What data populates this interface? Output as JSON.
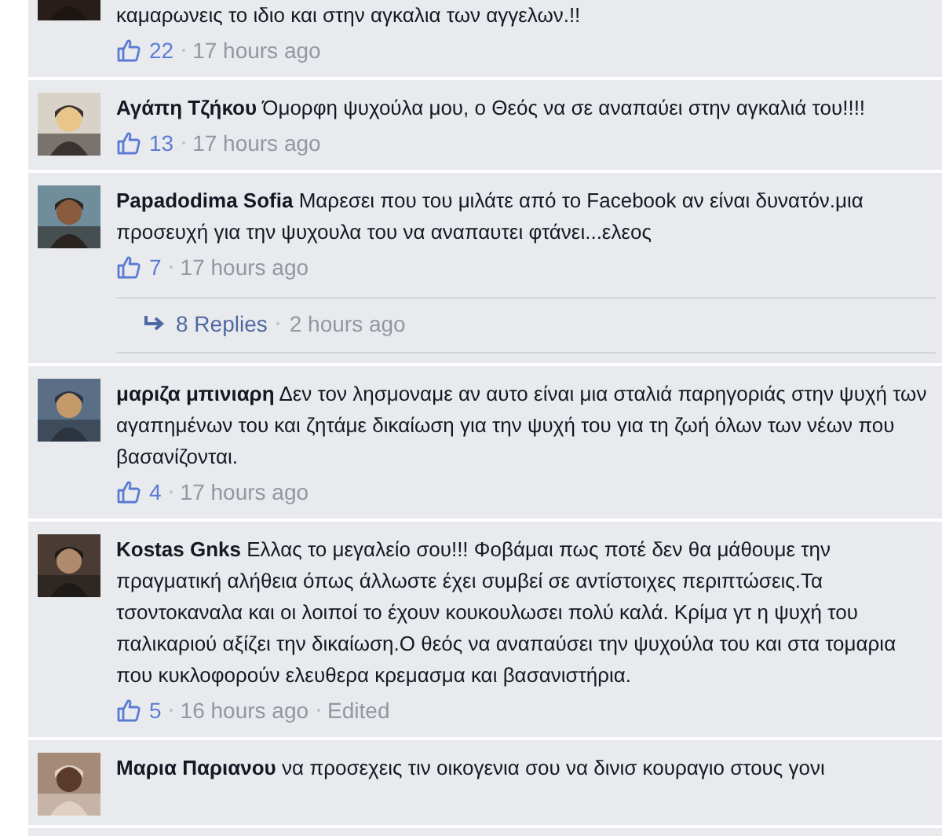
{
  "comments": [
    {
      "text": "καμαρωνεις το ιδιο και στην αγκαλια των αγγελων.!!",
      "likes": "22",
      "time": "17 hours ago"
    },
    {
      "author": "Αγάπη Τζήκου",
      "text": "Όμορφη ψυχούλα μου, ο Θεός να σε αναπαύει στην αγκαλιά του!!!!",
      "likes": "13",
      "time": "17 hours ago"
    },
    {
      "author": "Papadodima Sofia",
      "text": "Μαρεσει που του μιλάτε από το Facebook αν είναι δυνατόν.μια προσευχή για την ψυχουλα του να αναπαυτει φτάνει...ελεος",
      "likes": "7",
      "time": "17 hours ago",
      "replies": {
        "label": "8 Replies",
        "time": "2 hours ago"
      }
    },
    {
      "author": "μαριζα μπινιαρη",
      "text": "Δεν τον λησμοναμε αν αυτο είναι μια σταλιά παρηγοριάς στην ψυχή των αγαπημένων του και ζητάμε δικαίωση για την ψυχή του για τη ζωή όλων των νέων που βασανίζονται.",
      "likes": "4",
      "time": "17 hours ago"
    },
    {
      "author": "Kostas Gnks",
      "text": "Ελλας το μεγαλείο σου!!! Φοβάμαι πως ποτέ δεν θα μάθουμε την πραγματική αλήθεια όπως άλλωστε έχει συμβεί σε αντίστοιχες περιπτώσεις.Τα τσοντοκαναλα και οι λοιποί το έχουν κουκουλωσει πολύ καλά. Κρίμα γτ η ψυχή του παλικαριού αξίζει την δικαίωση.Ο θεός να αναπαύσει την ψυχούλα του και στα τομαρια που κυκλοφορούν ελευθερα κρεμασμα και βασανιστήρια.",
      "likes": "5",
      "time": "16 hours ago",
      "edited": "Edited"
    },
    {
      "author": "Μαρια Παριανου",
      "text": "να προσεχεις τιν οικογενια σου να δινισ κουραγιο στους γονι"
    }
  ]
}
